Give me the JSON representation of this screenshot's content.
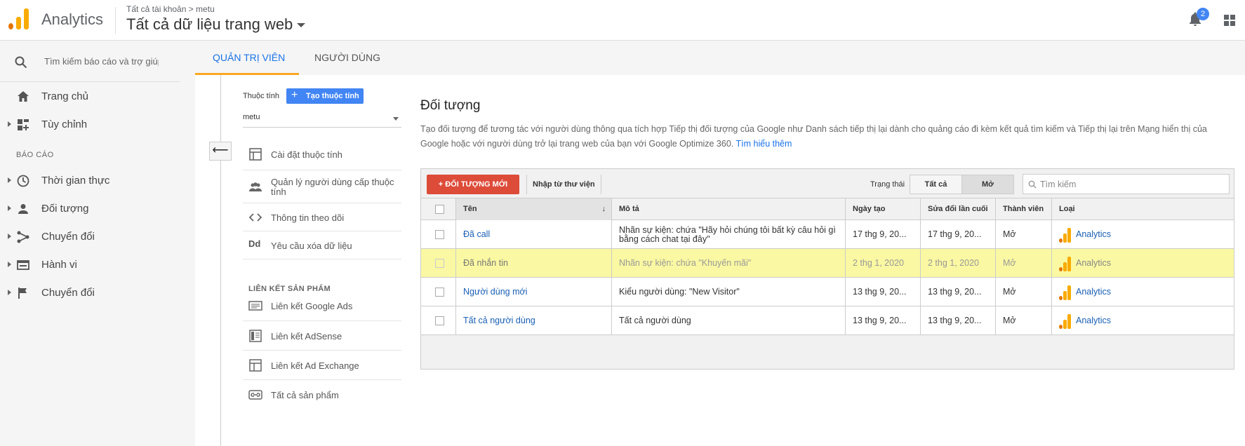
{
  "app": {
    "name": "Analytics"
  },
  "header": {
    "breadcrumb": "Tất cả tài khoản > metu",
    "view_title": "Tất cả dữ liệu trang web",
    "notification_count": "2"
  },
  "sidebar": {
    "search_placeholder": "Tìm kiếm báo cáo và trợ giúp",
    "home": "Trang chủ",
    "customize": "Tùy chỉnh",
    "reports_section": "BÁO CÁO",
    "items": [
      "Thời gian thực",
      "Đối tượng",
      "Chuyển đổi",
      "Hành vi",
      "Chuyển đổi"
    ]
  },
  "tabs": {
    "admin": "QUẢN TRỊ VIÊN",
    "users": "NGƯỜI DÙNG"
  },
  "property": {
    "label": "Thuộc tính",
    "create_button": "Tạo thuộc tính",
    "selected": "metu",
    "menu": [
      {
        "label": "Cài đặt thuộc tính",
        "icon": "window-icon"
      },
      {
        "label": "Quản lý người dùng cấp thuộc tính",
        "icon": "people-icon"
      },
      {
        "label": "Thông tin theo dõi",
        "icon": "code-icon"
      },
      {
        "label": "Yêu cầu xóa dữ liệu",
        "icon": "dd-icon"
      }
    ],
    "links_heading": "LIÊN KẾT SẢN PHẨM",
    "links": [
      {
        "label": "Liên kết Google Ads",
        "icon": "ads-icon"
      },
      {
        "label": "Liên kết AdSense",
        "icon": "adsense-icon"
      },
      {
        "label": "Liên kết Ad Exchange",
        "icon": "adexchange-icon"
      },
      {
        "label": "Tất cả sản phẩm",
        "icon": "link-icon"
      }
    ]
  },
  "main": {
    "title": "Đối tượng",
    "description": "Tạo đối tượng để tương tác với người dùng thông qua tích hợp Tiếp thị đối tượng của Google như Danh sách tiếp thị lại dành cho quảng cáo đi kèm kết quả tìm kiếm và Tiếp thị lại trên Mạng hiển thị của Google hoặc với người dùng trở lại trang web của bạn với Google Optimize 360.",
    "learn_more": "Tìm hiểu thêm",
    "new_audience_button": "+ ĐỐI TƯỢNG MỚI",
    "import_link": "Nhập từ thư viện",
    "status_label": "Trạng thái",
    "filter_all": "Tất cả",
    "filter_open": "Mở",
    "search_placeholder": "Tìm kiếm",
    "columns": [
      "Tên",
      "Mô tả",
      "Ngày tạo",
      "Sửa đổi lần cuối",
      "Thành viên",
      "Loại"
    ],
    "rows": [
      {
        "name": "Đã call",
        "desc": "Nhãn sự kiện: chứa \"Hãy hỏi chúng tôi bất kỳ câu hỏi gì bằng cách chat tại đây\"",
        "created": "17 thg 9, 20...",
        "modified": "17 thg 9, 20...",
        "members": "Mở",
        "type": "Analytics"
      },
      {
        "name": "Đã nhắn tin",
        "desc": "Nhãn sự kiện: chứa \"Khuyến mãi\"",
        "created": "2 thg 1, 2020",
        "modified": "2 thg 1, 2020",
        "members": "Mở",
        "type": "Analytics"
      },
      {
        "name": "Người dùng mới",
        "desc": "Kiểu người dùng: \"New Visitor\"",
        "created": "13 thg 9, 20...",
        "modified": "13 thg 9, 20...",
        "members": "Mở",
        "type": "Analytics"
      },
      {
        "name": "Tất cả người dùng",
        "desc": "Tất cả người dùng",
        "created": "13 thg 9, 20...",
        "modified": "13 thg 9, 20...",
        "members": "Mở",
        "type": "Analytics"
      }
    ]
  },
  "colors": {
    "accent": "#1a73e8",
    "ga_orange": "#f9ab00",
    "ga_dark_orange": "#e37400",
    "new_button": "#dd4b39",
    "highlight": "#faf8a2"
  }
}
